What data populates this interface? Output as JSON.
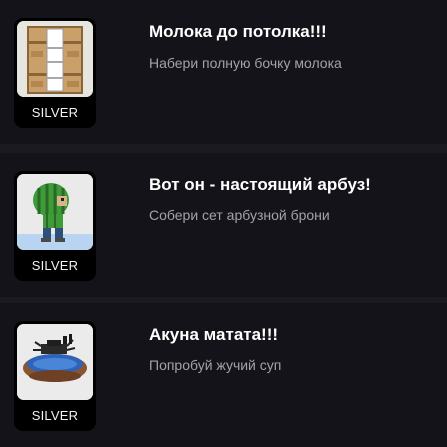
{
  "achievements": [
    {
      "title": "Молока до потолка!!!",
      "description": "Набери полную бочку молока",
      "tier": "SILVER",
      "icon": "milk-barrel-icon"
    },
    {
      "title": "Вот он - настоящий арбуз!",
      "description": "Собери сет арбузной брони",
      "tier": "SILVER",
      "icon": "watermelon-armor-icon"
    },
    {
      "title": "Акуна матата!!!",
      "description": "Попробуй жучий суп",
      "tier": "SILVER",
      "icon": "bug-soup-icon"
    }
  ]
}
